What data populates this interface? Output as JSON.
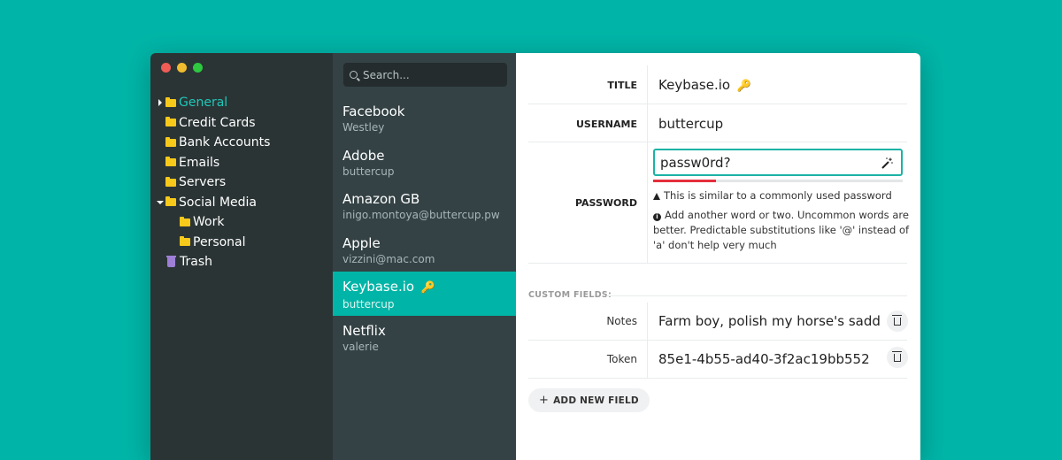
{
  "sidebar": {
    "items": [
      {
        "label": "General",
        "active": true,
        "expanded": false,
        "icon": "folder-icon"
      },
      {
        "label": "Credit Cards",
        "icon": "folder-icon"
      },
      {
        "label": "Bank Accounts",
        "icon": "folder-icon"
      },
      {
        "label": "Emails",
        "icon": "folder-icon"
      },
      {
        "label": "Servers",
        "icon": "folder-icon"
      },
      {
        "label": "Social Media",
        "expanded": true,
        "icon": "folder-icon"
      },
      {
        "label": "Work",
        "icon": "folder-icon"
      },
      {
        "label": "Personal",
        "icon": "folder-icon"
      },
      {
        "label": "Trash",
        "icon": "trash-icon"
      }
    ]
  },
  "search": {
    "placeholder": "Search..."
  },
  "entries": [
    {
      "title": "Facebook",
      "subtitle": "Westley"
    },
    {
      "title": "Adobe",
      "subtitle": "buttercup"
    },
    {
      "title": "Amazon GB",
      "subtitle": "inigo.montoya@buttercup.pw"
    },
    {
      "title": "Apple",
      "subtitle": "vizzini@mac.com"
    },
    {
      "title": "Keybase.io",
      "subtitle": "buttercup",
      "selected": true
    },
    {
      "title": "Netflix",
      "subtitle": "valerie"
    }
  ],
  "detail": {
    "title_label": "TITLE",
    "title_value": "Keybase.io",
    "username_label": "USERNAME",
    "username_value": "buttercup",
    "password_label": "PASSWORD",
    "password_value": "passw0rd?",
    "password_strength": 0.25,
    "warning": "This is similar to a commonly used password",
    "suggestion": "Add another word or two. Uncommon words are better. Predictable substitutions like '@' instead of 'a' don't help very much",
    "custom_fields_header": "CUSTOM FIELDS:",
    "custom_fields": [
      {
        "label": "Notes",
        "value": "Farm boy, polish my horse's saddle. I"
      },
      {
        "label": "Token",
        "value": "85e1-4b55-ad40-3f2ac19bb552"
      }
    ],
    "add_field_label": "ADD NEW FIELD"
  },
  "colors": {
    "background": "#00b5a7",
    "sidebar": "#2b3435",
    "list": "#344245",
    "accent": "#1ec8b8",
    "strength_weak": "#e42e3c",
    "folder": "#f7c91a",
    "trash": "#9d7fd6"
  },
  "icons": {
    "key": "🔑",
    "plus": "+"
  }
}
